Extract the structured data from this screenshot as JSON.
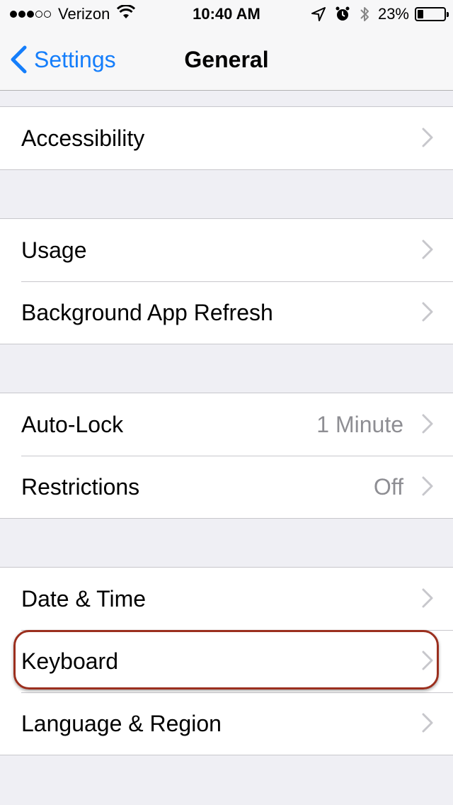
{
  "status_bar": {
    "carrier": "Verizon",
    "time": "10:40 AM",
    "battery_percent": "23%",
    "battery_level": 0.23,
    "signal_bars_on": 3,
    "signal_bars_total": 5,
    "icons": [
      "wifi-icon",
      "location-arrow-icon",
      "alarm-icon",
      "bluetooth-icon",
      "battery-icon"
    ]
  },
  "nav": {
    "back_label": "Settings",
    "title": "General",
    "accent_color": "#157efb"
  },
  "groups": [
    {
      "rows": [
        {
          "label": "Accessibility",
          "value": ""
        }
      ]
    },
    {
      "rows": [
        {
          "label": "Usage",
          "value": ""
        },
        {
          "label": "Background App Refresh",
          "value": ""
        }
      ]
    },
    {
      "rows": [
        {
          "label": "Auto-Lock",
          "value": "1 Minute"
        },
        {
          "label": "Restrictions",
          "value": "Off"
        }
      ]
    },
    {
      "rows": [
        {
          "label": "Date & Time",
          "value": ""
        },
        {
          "label": "Keyboard",
          "value": ""
        },
        {
          "label": "Language & Region",
          "value": ""
        }
      ]
    }
  ],
  "highlight": {
    "target": "Keyboard",
    "color": "#9b2f1e"
  }
}
